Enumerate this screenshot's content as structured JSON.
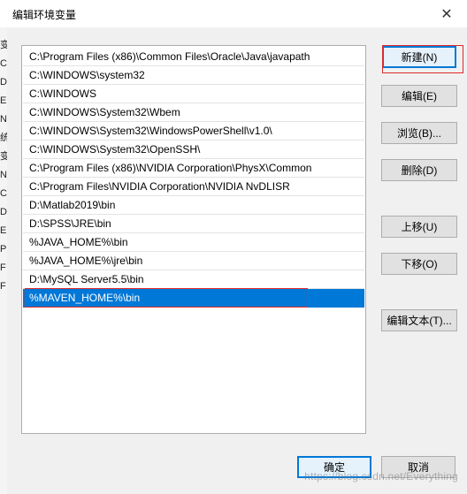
{
  "window": {
    "title": "编辑环境变量",
    "close_glyph": "✕"
  },
  "background_fragments": [
    "变",
    "C",
    "D",
    "E",
    "N",
    "统",
    "变",
    "N",
    "C",
    "D",
    "E",
    "P",
    "F",
    "F"
  ],
  "paths": [
    "C:\\Program Files (x86)\\Common Files\\Oracle\\Java\\javapath",
    "C:\\WINDOWS\\system32",
    "C:\\WINDOWS",
    "C:\\WINDOWS\\System32\\Wbem",
    "C:\\WINDOWS\\System32\\WindowsPowerShell\\v1.0\\",
    "C:\\WINDOWS\\System32\\OpenSSH\\",
    "C:\\Program Files (x86)\\NVIDIA Corporation\\PhysX\\Common",
    "C:\\Program Files\\NVIDIA Corporation\\NVIDIA NvDLISR",
    "D:\\Matlab2019\\bin",
    "D:\\SPSS\\JRE\\bin",
    "%JAVA_HOME%\\bin",
    "%JAVA_HOME%\\jre\\bin",
    "D:\\MySQL Server5.5\\bin",
    "%MAVEN_HOME%\\bin"
  ],
  "selected_index": 13,
  "buttons": {
    "new": "新建(N)",
    "edit": "编辑(E)",
    "browse": "浏览(B)...",
    "delete": "删除(D)",
    "move_up": "上移(U)",
    "move_down": "下移(O)",
    "edit_text": "编辑文本(T)...",
    "ok": "确定",
    "cancel": "取消"
  },
  "watermark": "https://blog.csdn.net/Everything",
  "colors": {
    "selection": "#0078d7",
    "highlight_box": "#e02a2a"
  }
}
